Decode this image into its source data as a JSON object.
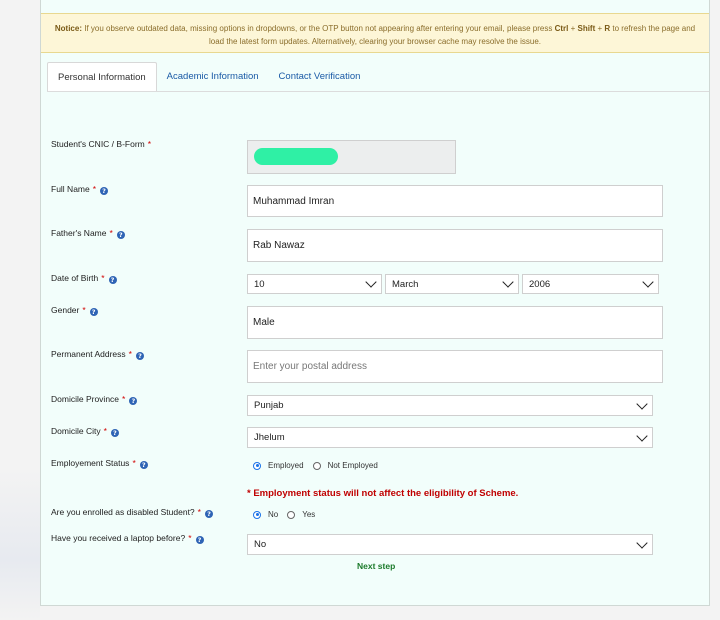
{
  "notice": {
    "label": "Notice:",
    "text_before": " If you observe outdated data, missing options in dropdowns, or the OTP button not appearing after entering your email, please press ",
    "key_ctrl": "Ctrl",
    "plus1": " + ",
    "key_shift": "Shift",
    "plus2": " + ",
    "key_r": "R",
    "text_after": " to refresh the page and load the latest form updates. Alternatively, clearing your browser cache may resolve the issue."
  },
  "tabs": [
    {
      "label": "Personal Information"
    },
    {
      "label": "Academic Information"
    },
    {
      "label": "Contact Verification"
    }
  ],
  "form": {
    "cnic": {
      "label": "Student's CNIC / B-Form",
      "req": "*"
    },
    "full_name": {
      "label": "Full Name",
      "req": "*",
      "value": "Muhammad Imran"
    },
    "father_name": {
      "label": "Father's Name",
      "req": "*",
      "value": "Rab Nawaz"
    },
    "dob": {
      "label": "Date of Birth",
      "req": "*",
      "day": "10",
      "month": "March",
      "year": "2006"
    },
    "gender": {
      "label": "Gender",
      "req": "*",
      "value": "Male"
    },
    "address": {
      "label": "Permanent Address",
      "req": "*",
      "placeholder": "Enter your postal address"
    },
    "province": {
      "label": "Domicile Province",
      "req": "*",
      "value": "Punjab"
    },
    "city": {
      "label": "Domicile City",
      "req": "*",
      "value": "Jhelum"
    },
    "employment": {
      "label": "Employement Status",
      "req": "*",
      "options": [
        "Employed",
        "Not Employed"
      ],
      "selected": "Employed"
    },
    "warning": "* Employment status will not affect the eligibility of Scheme.",
    "disabled": {
      "label": "Are you enrolled as disabled Student?",
      "req": "*",
      "options": [
        "No",
        "Yes"
      ],
      "selected": "No"
    },
    "laptop": {
      "label": "Have you received a laptop before?",
      "req": "*",
      "value": "No"
    }
  },
  "next_label": "Next step",
  "info_glyph": "?",
  "icons": [
    "info-icon",
    "chevron-down-icon",
    "radio-icon"
  ],
  "colors": {
    "accent": "#1a5aa6",
    "warning": "#c00000",
    "next": "#1b7a2a",
    "notice_bg": "#fdf6d7",
    "page_bg": "#f2fefb"
  }
}
